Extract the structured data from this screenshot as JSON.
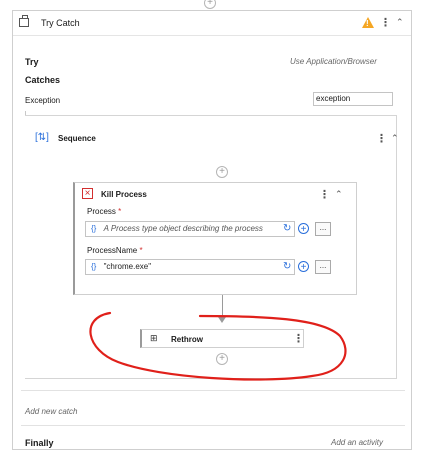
{
  "try_catch": {
    "title": "Try Catch",
    "try_label": "Try",
    "try_placeholder": "Use Application/Browser",
    "catches_label": "Catches",
    "exception_label": "Exception",
    "exception_value": "exception",
    "add_new_catch": "Add new catch",
    "finally_label": "Finally",
    "add_activity": "Add an activity"
  },
  "sequence": {
    "title": "Sequence"
  },
  "kill_process": {
    "title": "Kill Process",
    "process_label": "Process",
    "process_required": "*",
    "process_placeholder": "A Process type object describing the process",
    "processname_label": "ProcessName",
    "processname_required": "*",
    "processname_value": "\"chrome.exe\"",
    "expr_icon": "{}",
    "more_label": "..."
  },
  "rethrow": {
    "title": "Rethrow"
  },
  "icons": {
    "plus": "+",
    "warning": "!",
    "kebab": "⋮",
    "collapse": "≈",
    "sync": "↻"
  },
  "colors": {
    "accent": "#2a6fdb",
    "warning": "#f5a623",
    "error": "#d32f2f",
    "annotation": "#e0201a"
  }
}
